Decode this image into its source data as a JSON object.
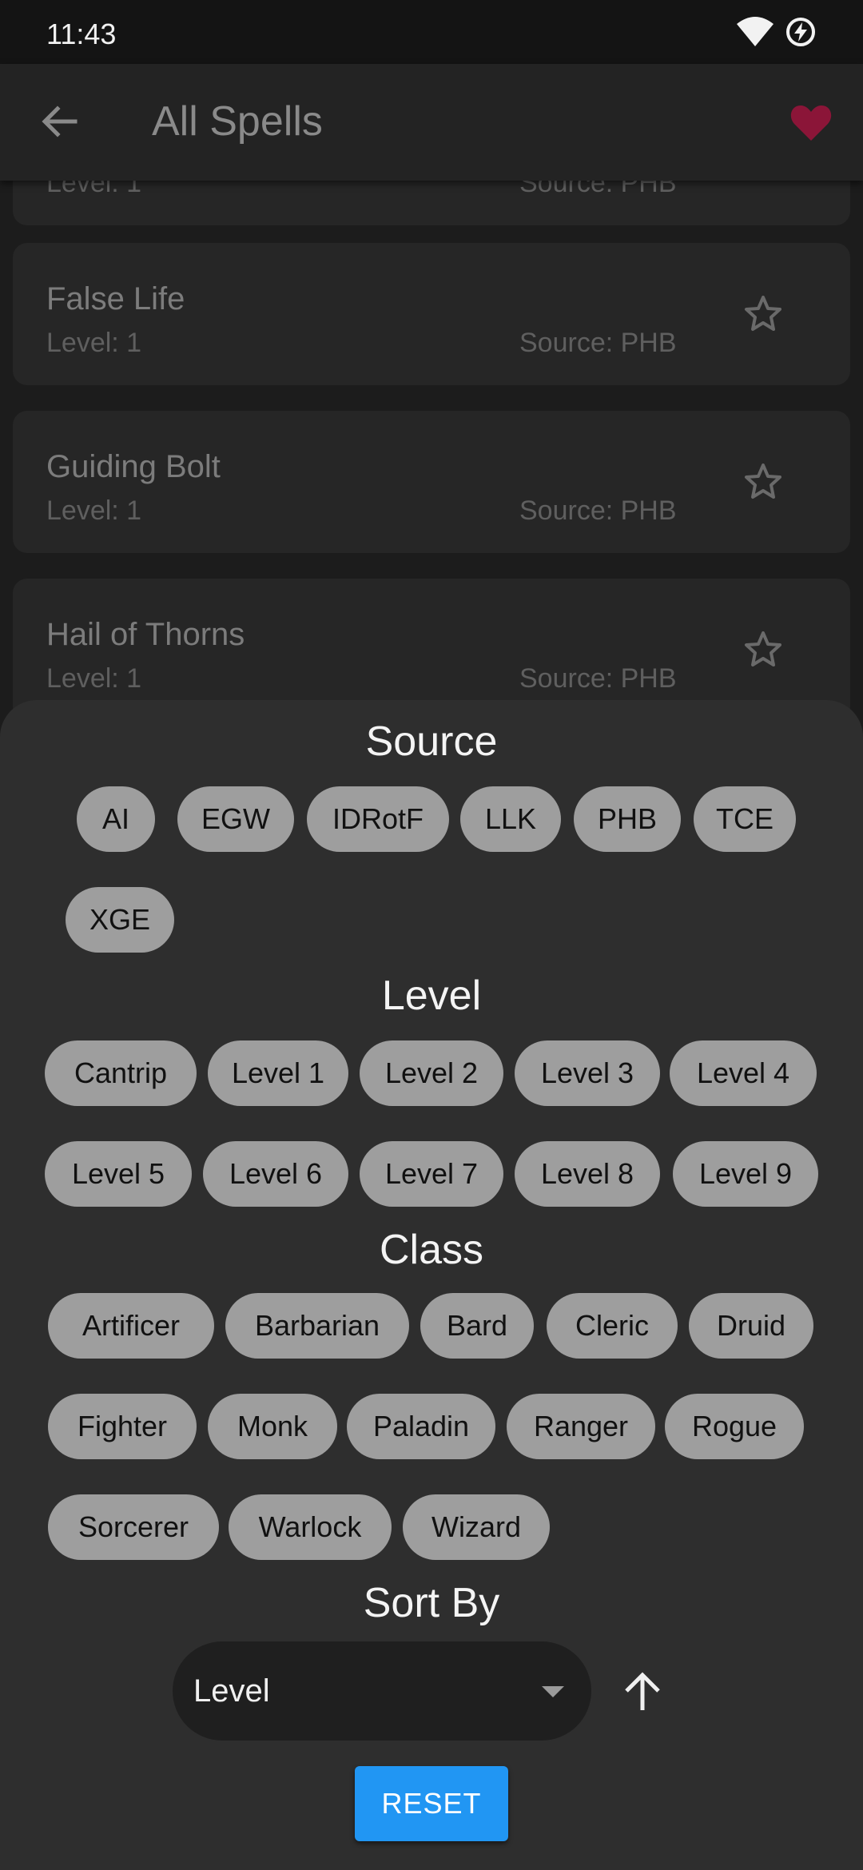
{
  "status": {
    "time": "11:43"
  },
  "appbar": {
    "title": "All Spells"
  },
  "spells": [
    {
      "name": "",
      "level": "Level: 1",
      "source": "Source: PHB"
    },
    {
      "name": "False Life",
      "level": "Level: 1",
      "source": "Source: PHB"
    },
    {
      "name": "Guiding Bolt",
      "level": "Level: 1",
      "source": "Source: PHB"
    },
    {
      "name": "Hail of Thorns",
      "level": "Level: 1",
      "source": "Source: PHB"
    }
  ],
  "filters": {
    "source_title": "Source",
    "sources": [
      "AI",
      "EGW",
      "IDRotF",
      "LLK",
      "PHB",
      "TCE",
      "XGE"
    ],
    "level_title": "Level",
    "levels": [
      "Cantrip",
      "Level 1",
      "Level 2",
      "Level 3",
      "Level 4",
      "Level 5",
      "Level 6",
      "Level 7",
      "Level 8",
      "Level 9"
    ],
    "class_title": "Class",
    "classes": [
      "Artificer",
      "Barbarian",
      "Bard",
      "Cleric",
      "Druid",
      "Fighter",
      "Monk",
      "Paladin",
      "Ranger",
      "Rogue",
      "Sorcerer",
      "Warlock",
      "Wizard"
    ],
    "sort_title": "Sort By",
    "sort_value": "Level",
    "reset_label": "RESET"
  },
  "colors": {
    "accent": "#2196f3",
    "favorite": "#8b1538",
    "chip": "#9e9e9e",
    "sheet": "#2e2e2e"
  }
}
